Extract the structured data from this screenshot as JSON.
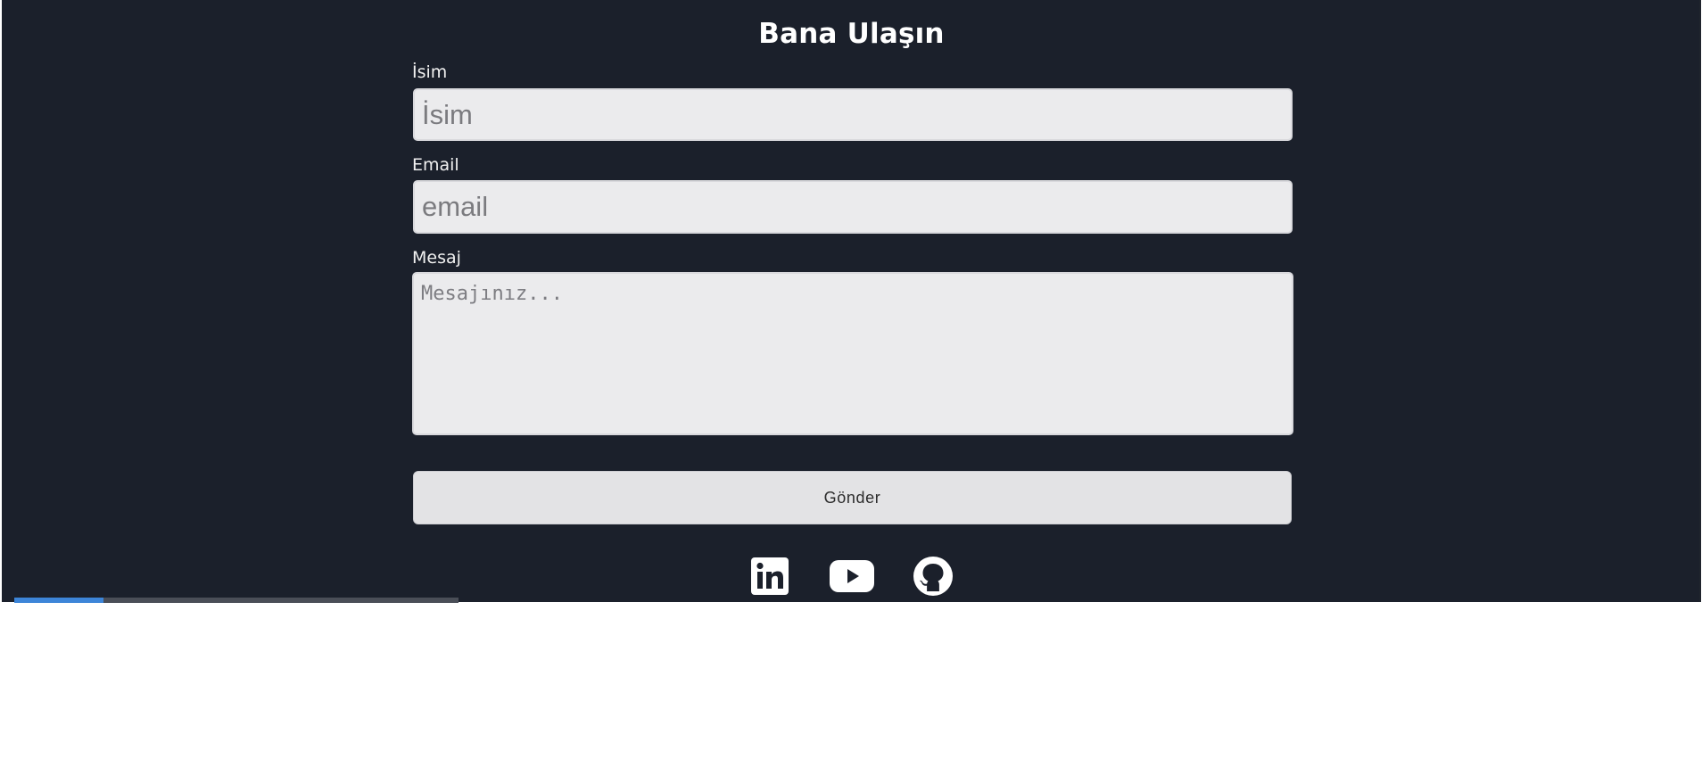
{
  "form": {
    "title": "Bana Ulaşın",
    "name_label": "İsim",
    "name_placeholder": "İsim",
    "name_value": "",
    "email_label": "Email",
    "email_placeholder": "email",
    "email_value": "",
    "message_label": "Mesaj",
    "message_placeholder": "Mesajınız...",
    "message_value": "",
    "submit_label": "Gönder"
  },
  "social": {
    "items": [
      {
        "name": "linkedin",
        "icon": "linkedin-icon"
      },
      {
        "name": "youtube",
        "icon": "youtube-icon"
      },
      {
        "name": "github",
        "icon": "github-icon"
      }
    ]
  },
  "video": {
    "progress_fraction": 0.2
  },
  "colors": {
    "background": "#1b202b",
    "field_background": "#ebebed",
    "text": "#ffffff",
    "progress": "#3d85d8"
  }
}
